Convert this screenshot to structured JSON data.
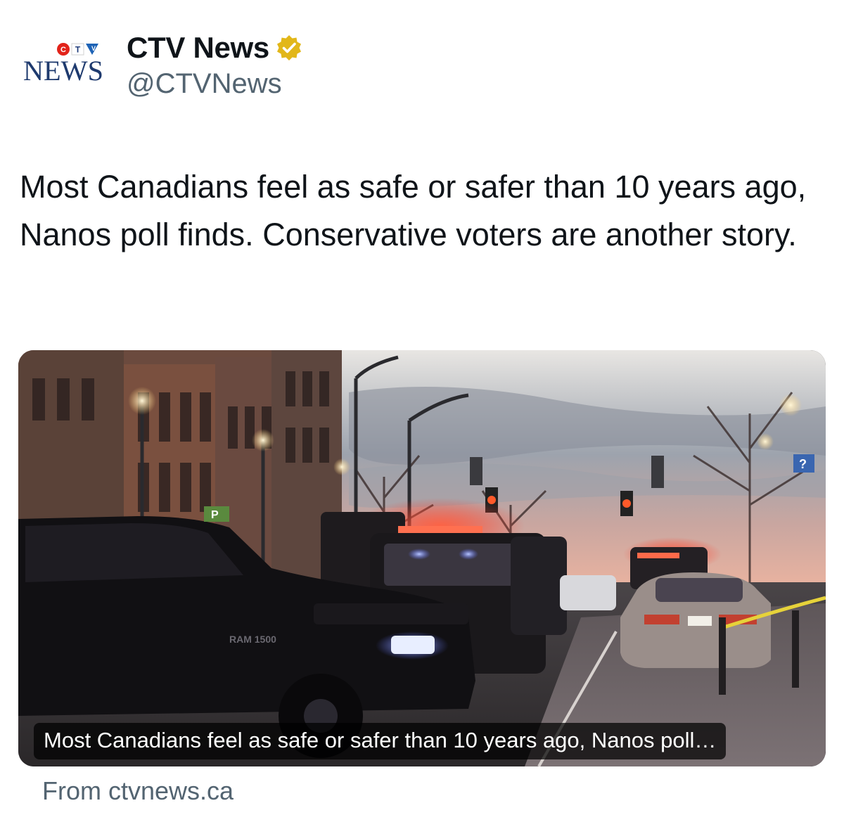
{
  "author": {
    "display_name": "CTV News",
    "handle": "@CTVNews",
    "verified": true,
    "avatar_logo_top": "CTV",
    "avatar_logo_bottom": "NEWS",
    "avatar_icon": "ctv-news-logo-icon",
    "verified_icon": "verified-badge-icon",
    "verified_color": "#e2b719"
  },
  "tweet": {
    "text": "Most Canadians feel as safe or safer than 10 years ago, Nanos poll finds. Conservative voters are another story."
  },
  "link_card": {
    "image_icon": "police-scene-street-photo",
    "title": "Most Canadians feel as safe or safer than 10 years ago, Nanos poll…",
    "source": "From ctvnews.ca"
  }
}
